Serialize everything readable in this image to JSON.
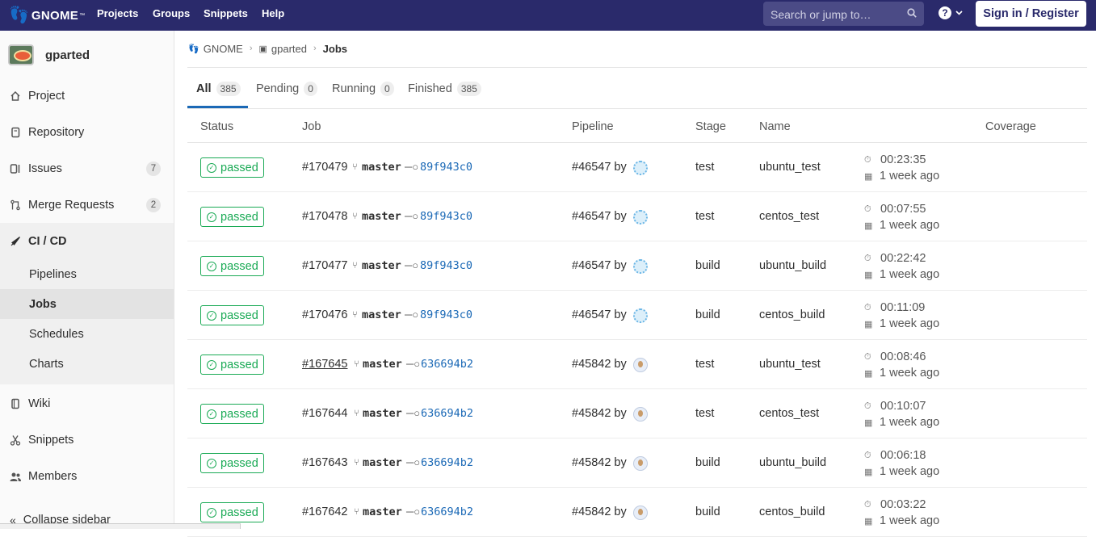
{
  "topnav": {
    "logo_text": "GNOME",
    "logo_tm": "™",
    "links": [
      "Projects",
      "Groups",
      "Snippets",
      "Help"
    ],
    "search_placeholder": "Search or jump to…",
    "help_label": "?",
    "signin_label": "Sign in / Register"
  },
  "sidebar": {
    "project_name": "gparted",
    "items": [
      {
        "label": "Project",
        "icon": "home-icon"
      },
      {
        "label": "Repository",
        "icon": "repository-icon"
      },
      {
        "label": "Issues",
        "icon": "issues-icon",
        "count": "7"
      },
      {
        "label": "Merge Requests",
        "icon": "merge-request-icon",
        "count": "2"
      },
      {
        "label": "CI / CD",
        "icon": "rocket-icon"
      },
      {
        "label": "Wiki",
        "icon": "book-icon"
      },
      {
        "label": "Snippets",
        "icon": "scissors-icon"
      },
      {
        "label": "Members",
        "icon": "users-icon"
      }
    ],
    "cicd_sub": [
      "Pipelines",
      "Jobs",
      "Schedules",
      "Charts"
    ],
    "collapse_label": "Collapse sidebar"
  },
  "breadcrumb": {
    "group": "GNOME",
    "project": "gparted",
    "current": "Jobs"
  },
  "tabs": [
    {
      "label": "All",
      "count": "385"
    },
    {
      "label": "Pending",
      "count": "0"
    },
    {
      "label": "Running",
      "count": "0"
    },
    {
      "label": "Finished",
      "count": "385"
    }
  ],
  "table": {
    "headers": [
      "Status",
      "Job",
      "Pipeline",
      "Stage",
      "Name",
      "Coverage"
    ],
    "rows": [
      {
        "status": "passed",
        "job": "#170479",
        "branch": "master",
        "sha": "89f943c0",
        "pipeline": "#46547 by",
        "stage": "test",
        "name": "ubuntu_test",
        "duration": "00:23:35",
        "when": "1 week ago"
      },
      {
        "status": "passed",
        "job": "#170478",
        "branch": "master",
        "sha": "89f943c0",
        "pipeline": "#46547 by",
        "stage": "test",
        "name": "centos_test",
        "duration": "00:07:55",
        "when": "1 week ago"
      },
      {
        "status": "passed",
        "job": "#170477",
        "branch": "master",
        "sha": "89f943c0",
        "pipeline": "#46547 by",
        "stage": "build",
        "name": "ubuntu_build",
        "duration": "00:22:42",
        "when": "1 week ago"
      },
      {
        "status": "passed",
        "job": "#170476",
        "branch": "master",
        "sha": "89f943c0",
        "pipeline": "#46547 by",
        "stage": "build",
        "name": "centos_build",
        "duration": "00:11:09",
        "when": "1 week ago"
      },
      {
        "status": "passed",
        "job": "#167645",
        "branch": "master",
        "sha": "636694b2",
        "pipeline": "#45842 by",
        "stage": "test",
        "name": "ubuntu_test",
        "duration": "00:08:46",
        "when": "1 week ago"
      },
      {
        "status": "passed",
        "job": "#167644",
        "branch": "master",
        "sha": "636694b2",
        "pipeline": "#45842 by",
        "stage": "test",
        "name": "centos_test",
        "duration": "00:10:07",
        "when": "1 week ago"
      },
      {
        "status": "passed",
        "job": "#167643",
        "branch": "master",
        "sha": "636694b2",
        "pipeline": "#45842 by",
        "stage": "build",
        "name": "ubuntu_build",
        "duration": "00:06:18",
        "when": "1 week ago"
      },
      {
        "status": "passed",
        "job": "#167642",
        "branch": "master",
        "sha": "636694b2",
        "pipeline": "#45842 by",
        "stage": "build",
        "name": "centos_build",
        "duration": "00:03:22",
        "when": "1 week ago"
      }
    ]
  },
  "colors": {
    "navbar": "#2a2a6b",
    "passed": "#1aaa55",
    "link": "#1b69b6"
  }
}
